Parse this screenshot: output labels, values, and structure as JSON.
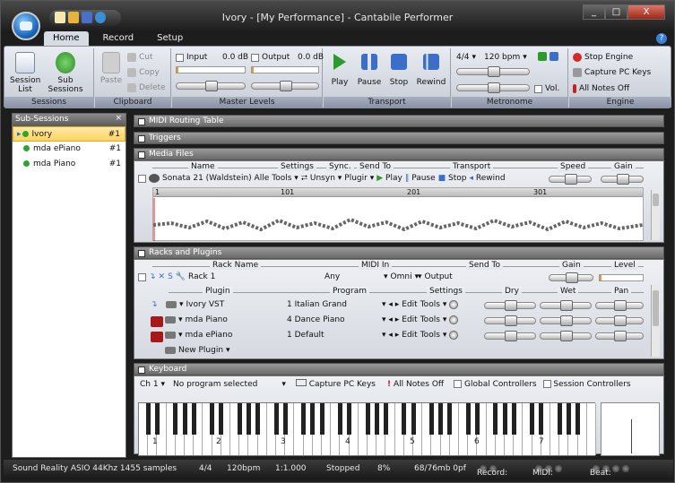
{
  "window": {
    "title": "Ivory - [My Performance] - Cantabile Performer",
    "min": "_",
    "max": "□",
    "close": "X"
  },
  "tabs": [
    "Home",
    "Record",
    "Setup"
  ],
  "help": "?",
  "ribbon": {
    "sessions": {
      "session_list": "Session List",
      "sub_sessions": "Sub Sessions",
      "label": "Sessions"
    },
    "clipboard": {
      "paste": "Paste",
      "cut": "Cut",
      "copy": "Copy",
      "delete": "Delete",
      "label": "Clipboard"
    },
    "levels": {
      "input": "Input",
      "input_db": "0.0 dB",
      "output": "Output",
      "output_db": "0.0 dB",
      "label": "Master Levels"
    },
    "transport": {
      "play": "Play",
      "pause": "Pause",
      "stop": "Stop",
      "rewind": "Rewind",
      "label": "Transport"
    },
    "metronome": {
      "sig": "4/4",
      "bpm": "120 bpm",
      "vol": "Vol.",
      "label": "Metronome"
    },
    "engine": {
      "stop": "Stop Engine",
      "capture": "Capture PC Keys",
      "notes_off": "All Notes Off",
      "label": "Engine"
    }
  },
  "sub_sessions": {
    "title": "Sub-Sessions",
    "close": "×",
    "items": [
      {
        "name": "Ivory",
        "num": "#1"
      },
      {
        "name": "mda ePiano",
        "num": "#1"
      },
      {
        "name": "mda Piano",
        "num": "#1"
      }
    ]
  },
  "panels": {
    "midi_routing": "MIDI Routing Table",
    "triggers": "Triggers",
    "media_files": "Media Files",
    "racks": "Racks and Plugins",
    "keyboard": "Keyboard"
  },
  "media": {
    "headers": [
      "Name",
      "Settings",
      "Sync.",
      "Send To",
      "Transport",
      "Speed",
      "Gain"
    ],
    "file": "Sonata 21 (Waldstein) Alle",
    "tools": "Tools",
    "sync": "Unsyn",
    "send": "Plugir",
    "play": "Play",
    "pause": "Pause",
    "stop": "Stop",
    "rewind": "Rewind",
    "ruler": [
      "1",
      "101",
      "201",
      "301"
    ]
  },
  "racks": {
    "headers": [
      "Rack Name",
      "MIDI In",
      "Send To",
      "Gain",
      "Level"
    ],
    "rack": {
      "name": "Rack 1",
      "midi": "Any",
      "channel": "Omni",
      "send": "Output"
    },
    "plugin_headers": [
      "Plugin",
      "Program",
      "Settings",
      "Dry",
      "Wet",
      "Pan"
    ],
    "plugins": [
      {
        "name": "Ivory VST",
        "program": "1 Italian Grand",
        "edit": "Edit",
        "tools": "Tools"
      },
      {
        "name": "mda Piano",
        "program": "4 Dance Piano",
        "edit": "Edit",
        "tools": "Tools"
      },
      {
        "name": "mda ePiano",
        "program": "1 Default",
        "edit": "Edit",
        "tools": "Tools"
      }
    ],
    "new_plugin": "New Plugin"
  },
  "keyboard": {
    "channel": "Ch 1",
    "program": "No program selected",
    "capture": "Capture PC Keys",
    "notes_off": "All Notes Off",
    "global": "Global Controllers",
    "session": "Session Controllers",
    "octaves": [
      "1",
      "2",
      "3",
      "4",
      "5",
      "6",
      "7"
    ]
  },
  "status": {
    "device": "Sound Reality ASIO 44Khz 1455 samples",
    "sig": "4/4",
    "bpm": "120bpm",
    "pos": "1:1.000",
    "state": "Stopped",
    "cpu": "8%",
    "mem": "68/76mb 0pf",
    "record": "Record:",
    "midi": "MIDI:",
    "beat": "Beat:"
  }
}
